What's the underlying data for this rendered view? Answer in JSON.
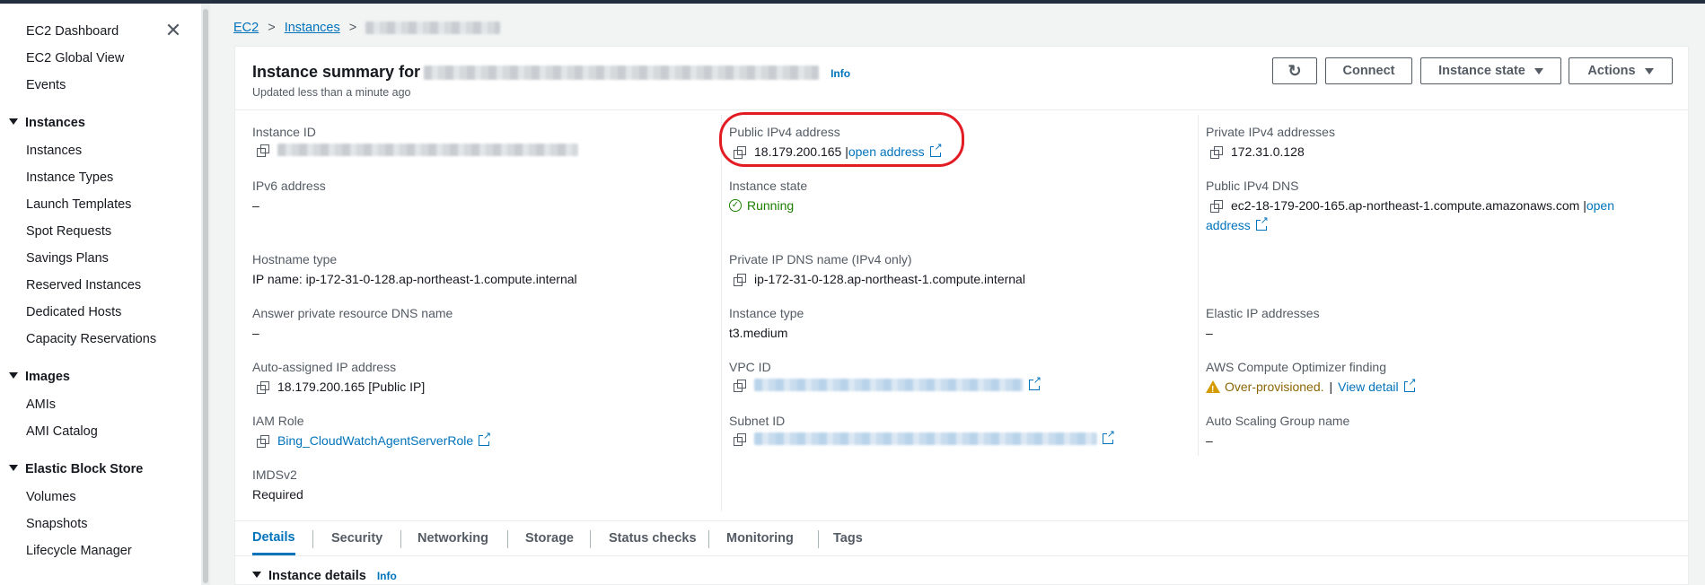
{
  "sidebar": {
    "top_items": [
      "EC2 Dashboard",
      "EC2 Global View",
      "Events"
    ],
    "sections": [
      {
        "title": "Instances",
        "items": [
          "Instances",
          "Instance Types",
          "Launch Templates",
          "Spot Requests",
          "Savings Plans",
          "Reserved Instances",
          "Dedicated Hosts",
          "Capacity Reservations"
        ]
      },
      {
        "title": "Images",
        "items": [
          "AMIs",
          "AMI Catalog"
        ]
      },
      {
        "title": "Elastic Block Store",
        "items": [
          "Volumes",
          "Snapshots",
          "Lifecycle Manager"
        ]
      }
    ],
    "close_icon": "close-icon"
  },
  "breadcrumb": {
    "ec2": "EC2",
    "instances": "Instances"
  },
  "summary": {
    "title": "Instance summary for",
    "info": "Info",
    "updated": "Updated less than a minute ago",
    "buttons": {
      "connect": "Connect",
      "instance_state": "Instance state",
      "actions": "Actions"
    }
  },
  "fields": {
    "instance_id_label": "Instance ID",
    "public_ipv4_label": "Public IPv4 address",
    "public_ipv4_value": "18.179.200.165 |",
    "open_address": "open address",
    "private_ipv4_label": "Private IPv4 addresses",
    "private_ipv4_value": "172.31.0.128",
    "ipv6_label": "IPv6 address",
    "ipv6_value": "–",
    "instance_state_label": "Instance state",
    "instance_state_value": "Running",
    "public_dns_label": "Public IPv4 DNS",
    "public_dns_value": "ec2-18-179-200-165.ap-northeast-1.compute.amazonaws.com |",
    "public_dns_link_1": "open",
    "public_dns_link_2": "address",
    "hostname_type_label": "Hostname type",
    "hostname_type_value": "IP name: ip-172-31-0-128.ap-northeast-1.compute.internal",
    "private_dns_label": "Private IP DNS name (IPv4 only)",
    "private_dns_value": "ip-172-31-0-128.ap-northeast-1.compute.internal",
    "answer_dns_label": "Answer private resource DNS name",
    "answer_dns_value": "–",
    "instance_type_label": "Instance type",
    "instance_type_value": "t3.medium",
    "elastic_ip_label": "Elastic IP addresses",
    "elastic_ip_value": "–",
    "auto_ip_label": "Auto-assigned IP address",
    "auto_ip_value": "18.179.200.165 [Public IP]",
    "vpc_label": "VPC ID",
    "optimizer_label": "AWS Compute Optimizer finding",
    "optimizer_value": "Over-provisioned.",
    "optimizer_sep": "|",
    "optimizer_link": "View detail",
    "iam_label": "IAM Role",
    "iam_value": "Bing_CloudWatchAgentServerRole",
    "subnet_label": "Subnet ID",
    "asg_label": "Auto Scaling Group name",
    "asg_value": "–",
    "imds_label": "IMDSv2",
    "imds_value": "Required"
  },
  "tabs": [
    "Details",
    "Security",
    "Networking",
    "Storage",
    "Status checks",
    "Monitoring",
    "Tags"
  ],
  "section": {
    "title": "Instance details",
    "info": "Info"
  },
  "colors": {
    "link": "#0073bb",
    "running": "#1d8102",
    "warning": "#8d6605",
    "highlight": "#e31b23"
  }
}
